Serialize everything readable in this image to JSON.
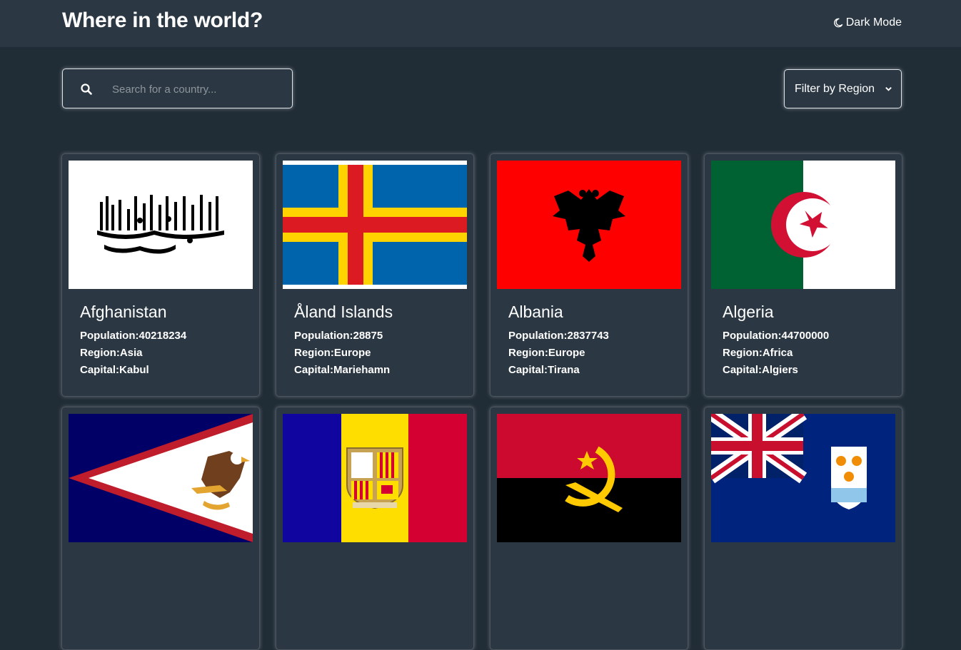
{
  "header": {
    "title": "Where in the world?",
    "mode_toggle_label": "Dark Mode",
    "mode_icon": "moon-icon"
  },
  "search": {
    "placeholder": "Search for a country...",
    "value": "",
    "icon": "search-icon"
  },
  "filter": {
    "selected": "Filter by Region",
    "icon": "chevron-down-icon"
  },
  "countries": [
    {
      "name": "Afghanistan",
      "population_label": "Population:",
      "population": "40218234",
      "region_label": "Region:",
      "region": "Asia",
      "capital_label": "Capital:",
      "capital": "Kabul",
      "flag": "afghanistan-flag"
    },
    {
      "name": "Åland Islands",
      "population_label": "Population:",
      "population": "28875",
      "region_label": "Region:",
      "region": "Europe",
      "capital_label": "Capital:",
      "capital": "Mariehamn",
      "flag": "aland-islands-flag"
    },
    {
      "name": "Albania",
      "population_label": "Population:",
      "population": "2837743",
      "region_label": "Region:",
      "region": "Europe",
      "capital_label": "Capital:",
      "capital": "Tirana",
      "flag": "albania-flag"
    },
    {
      "name": "Algeria",
      "population_label": "Population:",
      "population": "44700000",
      "region_label": "Region:",
      "region": "Africa",
      "capital_label": "Capital:",
      "capital": "Algiers",
      "flag": "algeria-flag"
    },
    {
      "flag": "american-samoa-flag"
    },
    {
      "flag": "andorra-flag"
    },
    {
      "flag": "angola-flag"
    },
    {
      "flag": "anguilla-flag"
    }
  ],
  "colors": {
    "background": "#202c36",
    "surface": "#2b3844",
    "text": "#ffffff"
  }
}
